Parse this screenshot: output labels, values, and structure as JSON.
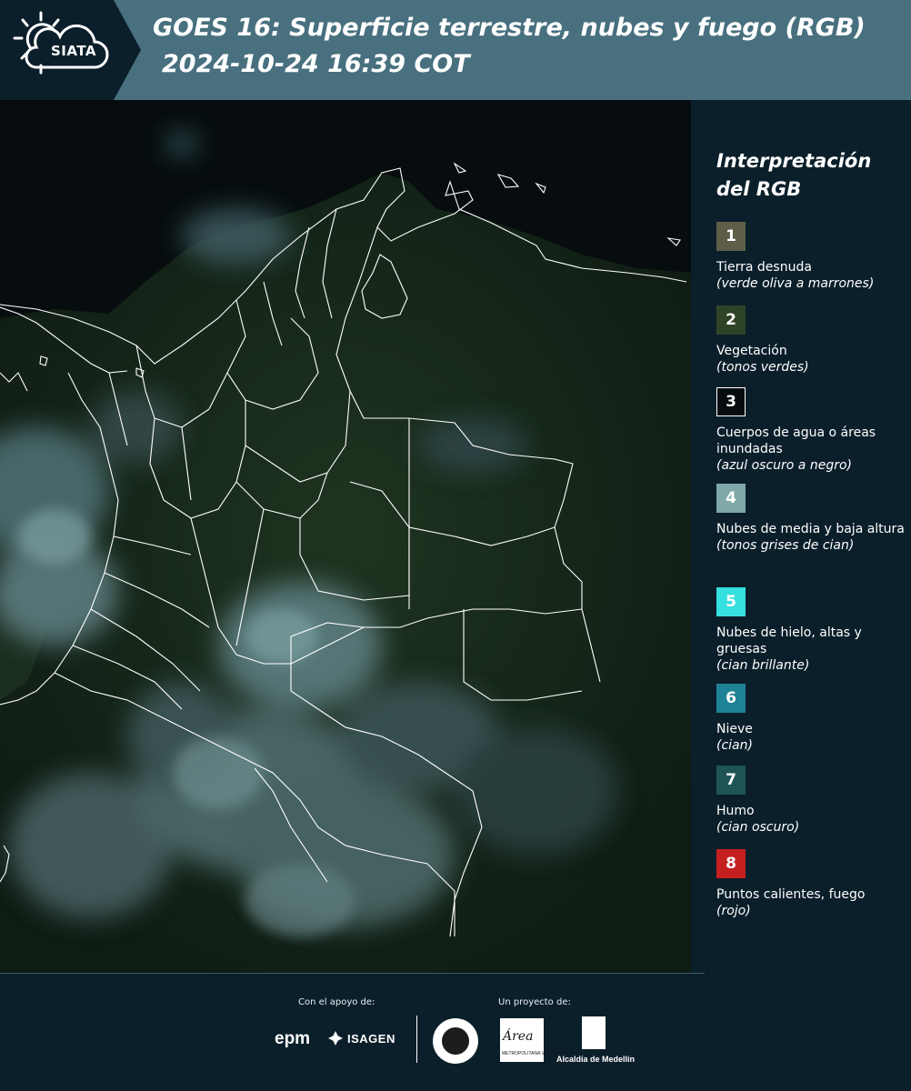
{
  "header": {
    "logo_text": "SIATA",
    "title_line1": "GOES 16: Superficie terrestre, nubes y fuego (RGB)",
    "title_line2": "2024-10-24 16:39 COT",
    "colors": {
      "band": "#48707f",
      "logo_band": "#0b1f2b"
    }
  },
  "legend": {
    "title": "Interpretación del RGB",
    "items": [
      {
        "number": "1",
        "label": "Tierra desnuda",
        "desc": "(verde oliva a marrones)",
        "color": "#5e5e48"
      },
      {
        "number": "2",
        "label": "Vegetación",
        "desc": "(tonos verdes)",
        "color": "#2f4426"
      },
      {
        "number": "3",
        "label": "Cuerpos de agua o áreas inundadas",
        "desc": "(azul oscuro a negro)",
        "color": "#070d0f"
      },
      {
        "number": "4",
        "label": "Nubes de media y baja altura",
        "desc": "(tonos grises de cian)",
        "color": "#7fa9a8"
      },
      {
        "number": "5",
        "label": "Nubes de hielo, altas y gruesas",
        "desc": "(cian brillante)",
        "color": "#36e0de"
      },
      {
        "number": "6",
        "label": "Nieve",
        "desc": "(cian)",
        "color": "#1f8196"
      },
      {
        "number": "7",
        "label": "Humo",
        "desc": "(cian oscuro)",
        "color": "#1e5454"
      },
      {
        "number": "8",
        "label": "Puntos calientes, fuego",
        "desc": "(rojo)",
        "color": "#c4201f"
      }
    ]
  },
  "footer": {
    "support_label": "Con el apoyo de:",
    "project_label": "Un proyecto de:",
    "sponsors": {
      "epm": "epm",
      "isagen": "ISAGEN"
    },
    "partners": {
      "area": "Área",
      "area_sub": "METROPOLITANA Valle de Aburrá",
      "alcaldia": "Alcaldía de Medellín"
    }
  }
}
